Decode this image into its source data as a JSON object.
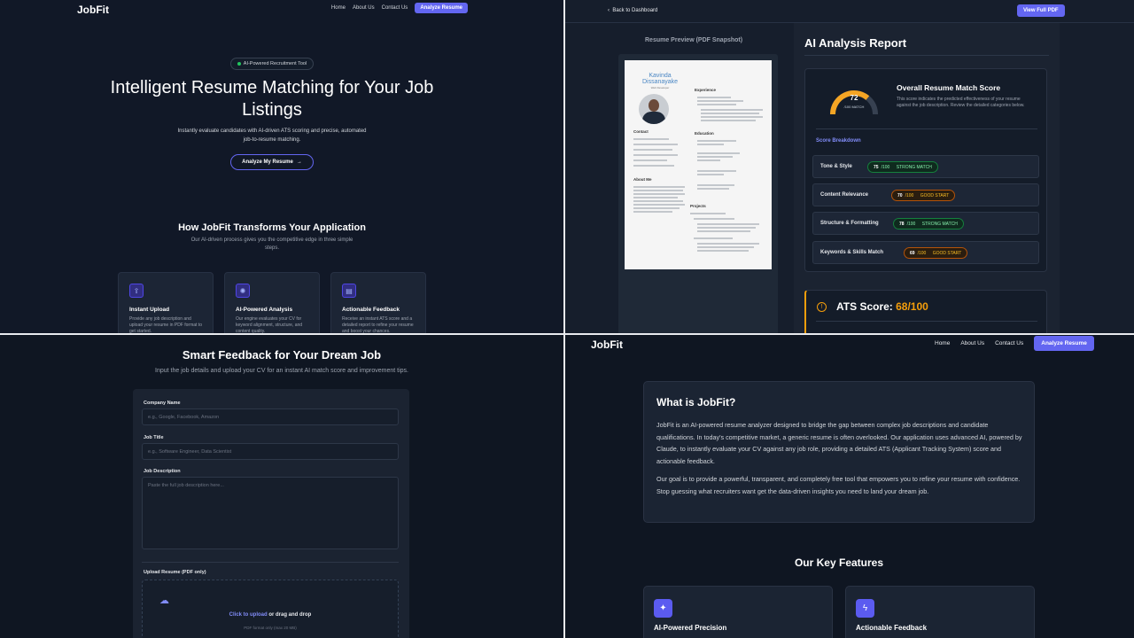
{
  "brand": "JobFit",
  "landing": {
    "nav": {
      "home": "Home",
      "about": "About Us",
      "contact": "Contact Us",
      "cta": "Analyze Resume"
    },
    "pill": "AI-Powered Recruitment Tool",
    "hero_title": "Intelligent Resume Matching for Your Job Listings",
    "hero_sub": "Instantly evaluate candidates with AI-driven ATS scoring and precise, automated job-to-resume matching.",
    "hero_button": "Analyze My Resume",
    "section_title": "How JobFit Transforms Your Application",
    "section_sub": "Our AI-driven process gives you the competitive edge in three simple steps.",
    "features": [
      {
        "title": "Instant Upload",
        "desc": "Provide any job description and upload your resume in PDF format to get started."
      },
      {
        "title": "AI-Powered Analysis",
        "desc": "Our engine evaluates your CV for keyword alignment, structure, and content quality."
      },
      {
        "title": "Actionable Feedback",
        "desc": "Receive an instant ATS score and a detailed report to refine your resume and boost your chances."
      }
    ]
  },
  "report": {
    "back": "Back to Dashboard",
    "view_pdf": "View Full PDF",
    "preview_label": "Resume Preview (PDF Snapshot)",
    "resume": {
      "name": "Kavinda Dissanayake",
      "role": "Web Developer",
      "sections": {
        "experience": "Experience",
        "education": "Education",
        "contact": "Contact",
        "about": "About Me",
        "projects": "Projects"
      }
    },
    "title": "AI Analysis Report",
    "gauge_value": "72",
    "gauge_sub": "/100 MATCH",
    "gauge_fraction": 0.72,
    "overall_title": "Overall Resume Match Score",
    "overall_desc": "This score indicates the predicted effectiveness of your resume against the job description. Review the detailed categories below.",
    "breakdown_title": "Score Breakdown",
    "scores": [
      {
        "label": "Tone & Style",
        "value": "75",
        "of": "/100",
        "tag": "STRONG MATCH",
        "kind": "green"
      },
      {
        "label": "Content Relevance",
        "value": "70",
        "of": "/100",
        "tag": "GOOD START",
        "kind": "amber"
      },
      {
        "label": "Structure & Formatting",
        "value": "78",
        "of": "/100",
        "tag": "STRONG MATCH",
        "kind": "green"
      },
      {
        "label": "Keywords & Skills Match",
        "value": "69",
        "of": "/100",
        "tag": "GOOD START",
        "kind": "amber"
      }
    ],
    "ats_label": "ATS Score: ",
    "ats_value": "68/100",
    "colors": {
      "accent": "#6366f1",
      "green": "#22c55e",
      "amber": "#f59e0b"
    }
  },
  "form": {
    "title": "Smart Feedback for Your Dream Job",
    "sub": "Input the job details and upload your CV for an instant AI match score and improvement tips.",
    "company_label": "Company Name",
    "company_placeholder": "e.g., Google, Facebook, Amazon",
    "job_title_label": "Job Title",
    "job_title_placeholder": "e.g., Software Engineer, Data Scientist",
    "job_desc_label": "Job Description",
    "job_desc_placeholder": "Paste the full job description here...",
    "upload_label": "Upload Resume (PDF only)",
    "upload_link": "Click to upload",
    "upload_rest": " or drag and drop",
    "upload_hint": "PDF format only (max 20 MB)"
  },
  "about": {
    "nav": {
      "home": "Home",
      "about": "About Us",
      "contact": "Contact Us",
      "cta": "Analyze Resume"
    },
    "what_title": "What is JobFit?",
    "p1": "JobFit is an AI-powered resume analyzer designed to bridge the gap between complex job descriptions and candidate qualifications. In today's competitive market, a generic resume is often overlooked. Our application uses advanced AI, powered by Claude, to instantly evaluate your CV against any job role, providing a detailed ATS (Applicant Tracking System) score and actionable feedback.",
    "p2": "Our goal is to provide a powerful, transparent, and completely free tool that empowers you to refine your resume with confidence. Stop guessing what recruiters want get the data-driven insights you need to land your dream job.",
    "features_title": "Our Key Features",
    "features": [
      {
        "title": "AI-Powered Precision"
      },
      {
        "title": "Actionable Feedback"
      }
    ]
  }
}
